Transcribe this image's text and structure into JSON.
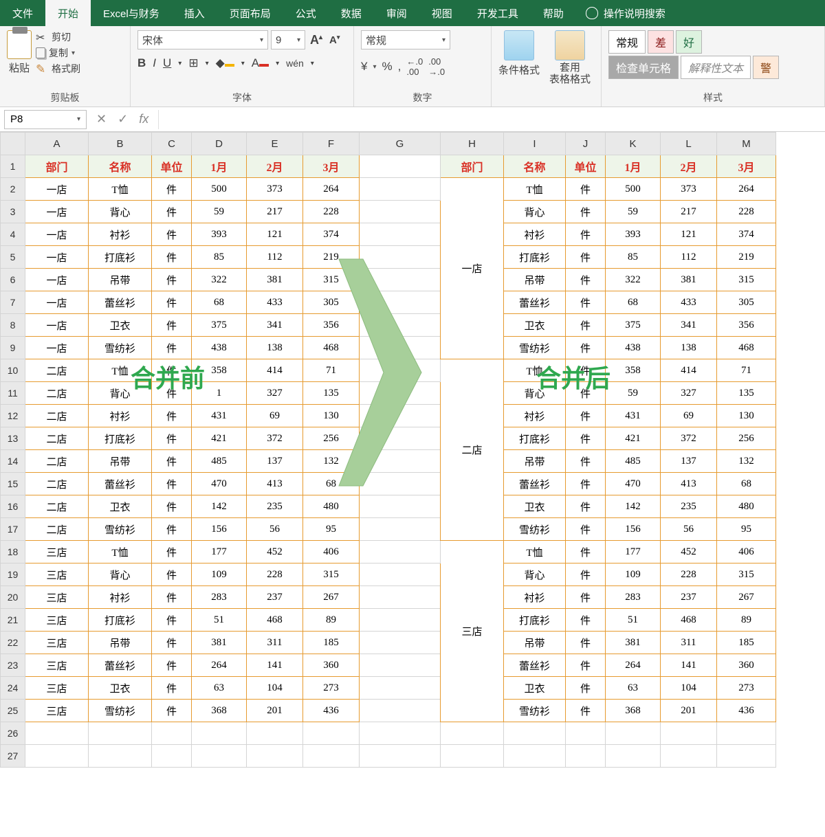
{
  "menu": {
    "tabs": [
      "文件",
      "开始",
      "Excel与财务",
      "插入",
      "页面布局",
      "公式",
      "数据",
      "审阅",
      "视图",
      "开发工具",
      "帮助"
    ],
    "activeIndex": 1,
    "searchPlaceholder": "操作说明搜索"
  },
  "ribbon": {
    "clipboard": {
      "paste": "粘贴",
      "cut": "剪切",
      "copy": "复制",
      "formatPainter": "格式刷",
      "label": "剪贴板"
    },
    "font": {
      "name": "宋体",
      "size": "9",
      "bold": "B",
      "italic": "I",
      "underline": "U",
      "label": "字体"
    },
    "number": {
      "format": "常规",
      "label": "数字"
    },
    "cond": {
      "condFormat": "条件格式",
      "tableFormat": "套用\n表格格式"
    },
    "styles": {
      "normal": "常规",
      "bad": "差",
      "good": "好",
      "check": "检查单元格",
      "explain": "解释性文本",
      "warn": "警",
      "label": "样式"
    }
  },
  "formulaBar": {
    "nameBox": "P8",
    "fx": "fx"
  },
  "columns": [
    "A",
    "B",
    "C",
    "D",
    "E",
    "F",
    "G",
    "H",
    "I",
    "J",
    "K",
    "L",
    "M"
  ],
  "rowNumbers": [
    1,
    2,
    3,
    4,
    5,
    6,
    7,
    8,
    9,
    10,
    11,
    12,
    13,
    14,
    15,
    16,
    17,
    18,
    19,
    20,
    21,
    22,
    23,
    24,
    25,
    26,
    27
  ],
  "headerRow": [
    "部门",
    "名称",
    "单位",
    "1月",
    "2月",
    "3月"
  ],
  "leftData": [
    [
      "一店",
      "T恤",
      "件",
      "500",
      "373",
      "264"
    ],
    [
      "一店",
      "背心",
      "件",
      "59",
      "217",
      "228"
    ],
    [
      "一店",
      "衬衫",
      "件",
      "393",
      "121",
      "374"
    ],
    [
      "一店",
      "打底衫",
      "件",
      "85",
      "112",
      "219"
    ],
    [
      "一店",
      "吊带",
      "件",
      "322",
      "381",
      "315"
    ],
    [
      "一店",
      "蕾丝衫",
      "件",
      "68",
      "433",
      "305"
    ],
    [
      "一店",
      "卫衣",
      "件",
      "375",
      "341",
      "356"
    ],
    [
      "一店",
      "雪纺衫",
      "件",
      "438",
      "138",
      "468"
    ],
    [
      "二店",
      "T恤",
      "件",
      "358",
      "414",
      "71"
    ],
    [
      "二店",
      "背心",
      "件",
      "1",
      "327",
      "135"
    ],
    [
      "二店",
      "衬衫",
      "件",
      "431",
      "69",
      "130"
    ],
    [
      "二店",
      "打底衫",
      "件",
      "421",
      "372",
      "256"
    ],
    [
      "二店",
      "吊带",
      "件",
      "485",
      "137",
      "132"
    ],
    [
      "二店",
      "蕾丝衫",
      "件",
      "470",
      "413",
      "68"
    ],
    [
      "二店",
      "卫衣",
      "件",
      "142",
      "235",
      "480"
    ],
    [
      "二店",
      "雪纺衫",
      "件",
      "156",
      "56",
      "95"
    ],
    [
      "三店",
      "T恤",
      "件",
      "177",
      "452",
      "406"
    ],
    [
      "三店",
      "背心",
      "件",
      "109",
      "228",
      "315"
    ],
    [
      "三店",
      "衬衫",
      "件",
      "283",
      "237",
      "267"
    ],
    [
      "三店",
      "打底衫",
      "件",
      "51",
      "468",
      "89"
    ],
    [
      "三店",
      "吊带",
      "件",
      "381",
      "311",
      "185"
    ],
    [
      "三店",
      "蕾丝衫",
      "件",
      "264",
      "141",
      "360"
    ],
    [
      "三店",
      "卫衣",
      "件",
      "63",
      "104",
      "273"
    ],
    [
      "三店",
      "雪纺衫",
      "件",
      "368",
      "201",
      "436"
    ]
  ],
  "rightGroups": [
    {
      "dept": "一店",
      "rows": [
        [
          "T恤",
          "件",
          "500",
          "373",
          "264"
        ],
        [
          "背心",
          "件",
          "59",
          "217",
          "228"
        ],
        [
          "衬衫",
          "件",
          "393",
          "121",
          "374"
        ],
        [
          "打底衫",
          "件",
          "85",
          "112",
          "219"
        ],
        [
          "吊带",
          "件",
          "322",
          "381",
          "315"
        ],
        [
          "蕾丝衫",
          "件",
          "68",
          "433",
          "305"
        ],
        [
          "卫衣",
          "件",
          "375",
          "341",
          "356"
        ],
        [
          "雪纺衫",
          "件",
          "438",
          "138",
          "468"
        ]
      ]
    },
    {
      "dept": "二店",
      "rows": [
        [
          "T恤",
          "件",
          "358",
          "414",
          "71"
        ],
        [
          "背心",
          "件",
          "59",
          "327",
          "135"
        ],
        [
          "衬衫",
          "件",
          "431",
          "69",
          "130"
        ],
        [
          "打底衫",
          "件",
          "421",
          "372",
          "256"
        ],
        [
          "吊带",
          "件",
          "485",
          "137",
          "132"
        ],
        [
          "蕾丝衫",
          "件",
          "470",
          "413",
          "68"
        ],
        [
          "卫衣",
          "件",
          "142",
          "235",
          "480"
        ],
        [
          "雪纺衫",
          "件",
          "156",
          "56",
          "95"
        ]
      ]
    },
    {
      "dept": "三店",
      "rows": [
        [
          "T恤",
          "件",
          "177",
          "452",
          "406"
        ],
        [
          "背心",
          "件",
          "109",
          "228",
          "315"
        ],
        [
          "衬衫",
          "件",
          "283",
          "237",
          "267"
        ],
        [
          "打底衫",
          "件",
          "51",
          "468",
          "89"
        ],
        [
          "吊带",
          "件",
          "381",
          "311",
          "185"
        ],
        [
          "蕾丝衫",
          "件",
          "264",
          "141",
          "360"
        ],
        [
          "卫衣",
          "件",
          "63",
          "104",
          "273"
        ],
        [
          "雪纺衫",
          "件",
          "368",
          "201",
          "436"
        ]
      ]
    }
  ],
  "overlays": {
    "before": "合并前",
    "after": "合并后"
  }
}
